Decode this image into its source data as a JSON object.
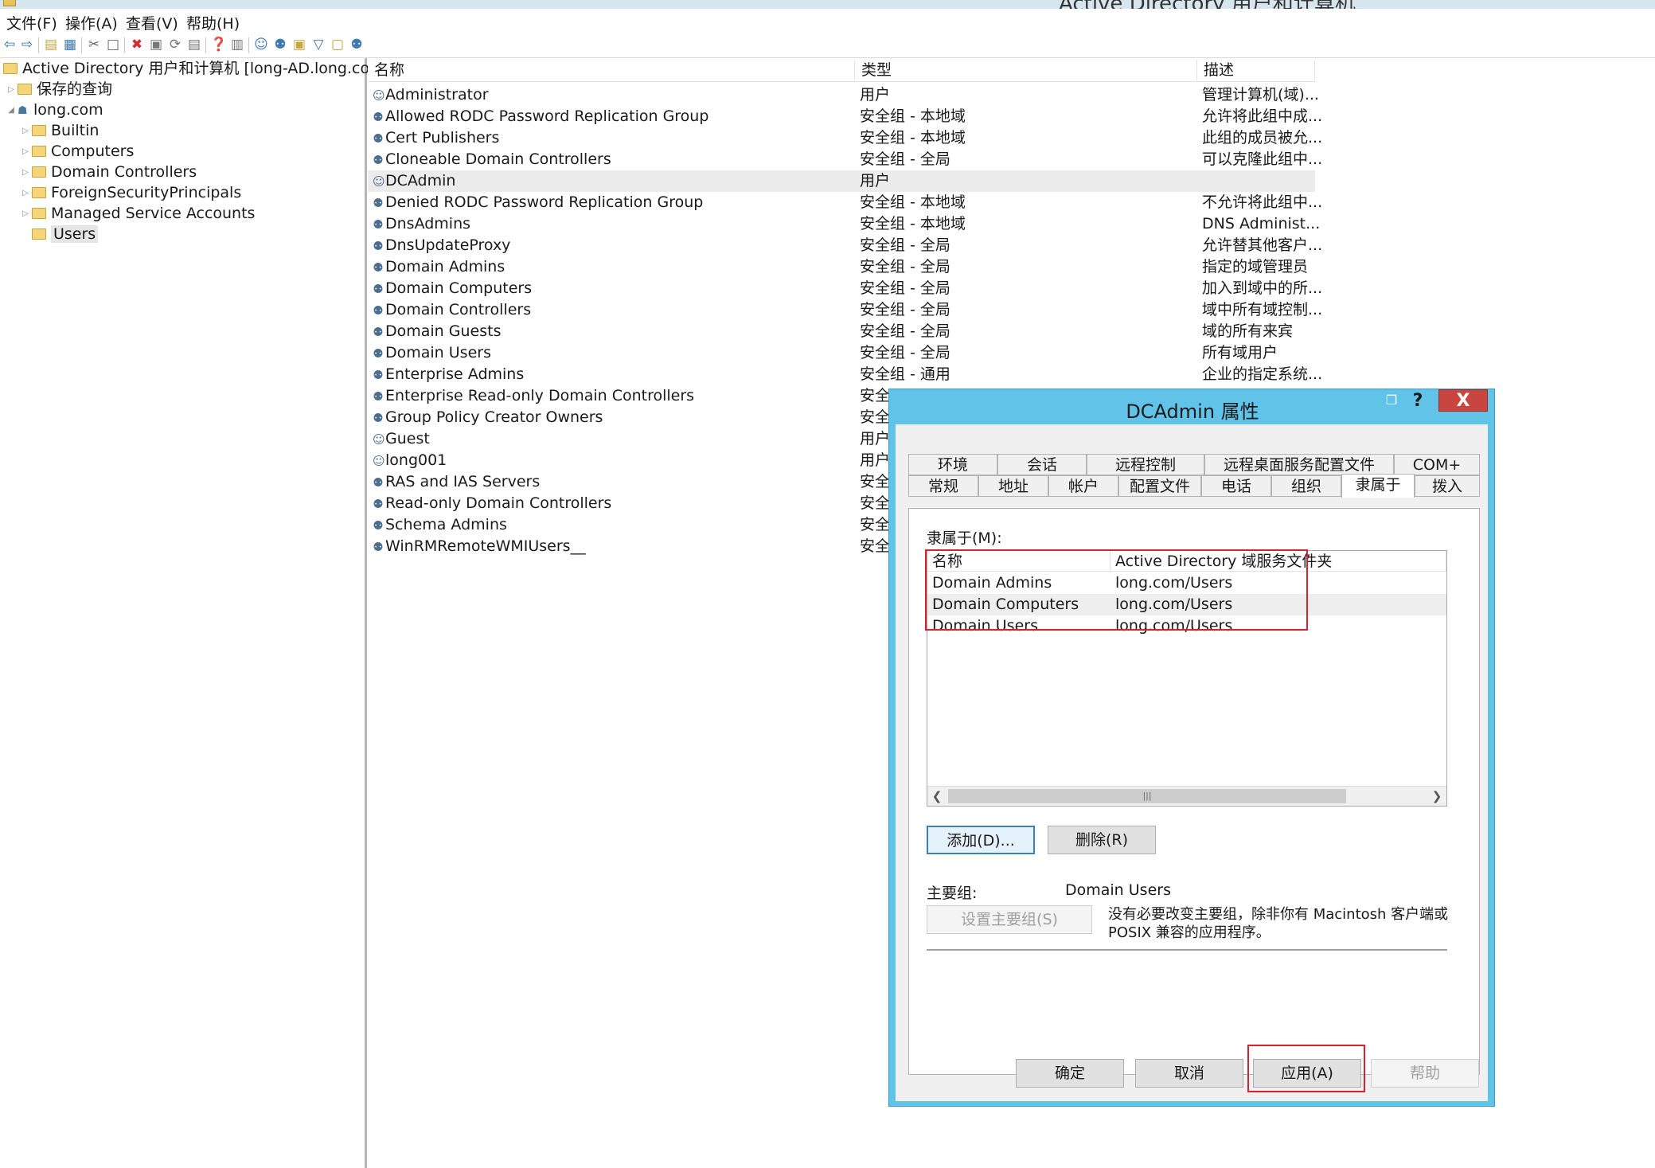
{
  "window": {
    "title": "Active Directory 用户和计算机"
  },
  "menu": [
    "文件(F)",
    "操作(A)",
    "查看(V)",
    "帮助(H)"
  ],
  "toolbar_icons": [
    "back-icon",
    "forward-icon",
    "up-folder-icon",
    "show-hide-tree-icon",
    "cut-icon",
    "copy-icon",
    "delete-icon",
    "properties-icon",
    "refresh-icon",
    "export-list-icon",
    "help-icon",
    "console-icon",
    "new-user-icon",
    "new-group-icon",
    "new-ou-icon",
    "filter-icon",
    "find-icon",
    "add-to-group-icon"
  ],
  "tree": {
    "root": "Active Directory 用户和计算机 [long-AD.long.com]",
    "saved_queries": "保存的查询",
    "domain": "long.com",
    "children": [
      "Builtin",
      "Computers",
      "Domain Controllers",
      "ForeignSecurityPrincipals",
      "Managed Service Accounts",
      "Users"
    ]
  },
  "list": {
    "headers": {
      "name": "名称",
      "type": "类型",
      "desc": "描述"
    },
    "rows": [
      {
        "name": "Administrator",
        "type": "用户",
        "desc": "管理计算机(域)...",
        "icon": "user-icon"
      },
      {
        "name": "Allowed RODC Password Replication Group",
        "type": "安全组 - 本地域",
        "desc": "允许将此组中成...",
        "icon": "group-icon"
      },
      {
        "name": "Cert Publishers",
        "type": "安全组 - 本地域",
        "desc": "此组的成员被允...",
        "icon": "group-icon"
      },
      {
        "name": "Cloneable Domain Controllers",
        "type": "安全组 - 全局",
        "desc": "可以克隆此组中...",
        "icon": "group-icon"
      },
      {
        "name": "DCAdmin",
        "type": "用户",
        "desc": "",
        "icon": "user-icon"
      },
      {
        "name": "Denied RODC Password Replication Group",
        "type": "安全组 - 本地域",
        "desc": "不允许将此组中...",
        "icon": "group-icon"
      },
      {
        "name": "DnsAdmins",
        "type": "安全组 - 本地域",
        "desc": "DNS Administ...",
        "icon": "group-icon"
      },
      {
        "name": "DnsUpdateProxy",
        "type": "安全组 - 全局",
        "desc": "允许替其他客户...",
        "icon": "group-icon"
      },
      {
        "name": "Domain Admins",
        "type": "安全组 - 全局",
        "desc": "指定的域管理员",
        "icon": "group-icon"
      },
      {
        "name": "Domain Computers",
        "type": "安全组 - 全局",
        "desc": "加入到域中的所...",
        "icon": "group-icon"
      },
      {
        "name": "Domain Controllers",
        "type": "安全组 - 全局",
        "desc": "域中所有域控制...",
        "icon": "group-icon"
      },
      {
        "name": "Domain Guests",
        "type": "安全组 - 全局",
        "desc": "域的所有来宾",
        "icon": "group-icon"
      },
      {
        "name": "Domain Users",
        "type": "安全组 - 全局",
        "desc": "所有域用户",
        "icon": "group-icon"
      },
      {
        "name": "Enterprise Admins",
        "type": "安全组 - 通用",
        "desc": "企业的指定系统...",
        "icon": "group-icon"
      },
      {
        "name": "Enterprise Read-only Domain Controllers",
        "type": "安全",
        "desc": "",
        "icon": "group-icon"
      },
      {
        "name": "Group Policy Creator Owners",
        "type": "安全",
        "desc": "",
        "icon": "group-icon"
      },
      {
        "name": "Guest",
        "type": "用户",
        "desc": "",
        "icon": "user-icon"
      },
      {
        "name": "long001",
        "type": "用户",
        "desc": "",
        "icon": "user-icon"
      },
      {
        "name": "RAS and IAS Servers",
        "type": "安全",
        "desc": "",
        "icon": "group-icon"
      },
      {
        "name": "Read-only Domain Controllers",
        "type": "安全",
        "desc": "",
        "icon": "group-icon"
      },
      {
        "name": "Schema Admins",
        "type": "安全",
        "desc": "",
        "icon": "group-icon"
      },
      {
        "name": "WinRMRemoteWMIUsers__",
        "type": "安全",
        "desc": "",
        "icon": "group-icon"
      }
    ]
  },
  "dialog": {
    "title": "DCAdmin 属性",
    "help_glyph": "?",
    "close_glyph": "X",
    "tabs_row1": [
      "环境",
      "会话",
      "远程控制",
      "远程桌面服务配置文件",
      "COM+"
    ],
    "tabs_row2": [
      "常规",
      "地址",
      "帐户",
      "配置文件",
      "电话",
      "组织",
      "隶属于",
      "拨入"
    ],
    "member_of_label": "隶属于(M):",
    "grid_headers": {
      "name": "名称",
      "folder": "Active Directory 域服务文件夹"
    },
    "groups": [
      {
        "name": "Domain Admins",
        "folder": "long.com/Users"
      },
      {
        "name": "Domain Computers",
        "folder": "long.com/Users"
      },
      {
        "name": "Domain Users",
        "folder": "long.com/Users"
      }
    ],
    "add_button": "添加(D)...",
    "remove_button": "删除(R)",
    "primary_group_label": "主要组:",
    "primary_group_value": "Domain Users",
    "set_primary_button": "设置主要组(S)",
    "primary_note": "没有必要改变主要组，除非你有 Macintosh 客户端或 POSIX 兼容的应用程序。",
    "ok_button": "确定",
    "cancel_button": "取消",
    "apply_button": "应用(A)",
    "help_button": "帮助"
  },
  "colors": {
    "dialog_frame": "#62c3e9",
    "highlight_box": "#d4232f",
    "close_button": "#c9453f"
  }
}
